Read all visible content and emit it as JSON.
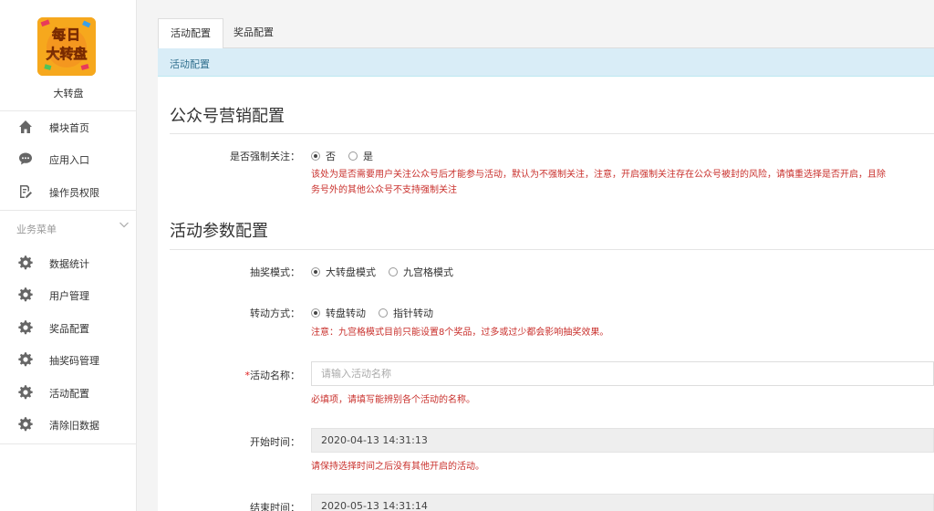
{
  "app": {
    "name": "大转盘",
    "logo_text_top": "每日",
    "logo_text_bottom": "大转盘"
  },
  "sidebar": {
    "items": [
      {
        "label": "模块首页",
        "icon": "home-icon"
      },
      {
        "label": "应用入口",
        "icon": "chat-bubble-icon"
      },
      {
        "label": "操作员权限",
        "icon": "edit-document-icon"
      }
    ],
    "group_title": "业务菜单",
    "group_items": [
      {
        "label": "数据统计",
        "icon": "gear-icon"
      },
      {
        "label": "用户管理",
        "icon": "gear-icon"
      },
      {
        "label": "奖品配置",
        "icon": "gear-icon"
      },
      {
        "label": "抽奖码管理",
        "icon": "gear-icon"
      },
      {
        "label": "活动配置",
        "icon": "gear-icon"
      },
      {
        "label": "清除旧数据",
        "icon": "gear-icon"
      }
    ]
  },
  "tabs": [
    {
      "label": "活动配置",
      "active": true
    },
    {
      "label": "奖品配置",
      "active": false
    }
  ],
  "panel_title": "活动配置",
  "section1": {
    "title": "公众号营销配置",
    "force_follow": {
      "label": "是否强制关注：",
      "options": [
        "否",
        "是"
      ],
      "selected": 0,
      "hint_line1": "该处为是否需要用户关注公众号后才能参与活动，默认为不强制关注，注意，开启强制关注存在公众号被封的风险，请慎重选择是否开启，且除",
      "hint_line2": "务号外的其他公众号不支持强制关注"
    }
  },
  "section2": {
    "title": "活动参数配置",
    "lottery_mode": {
      "label": "抽奖模式：",
      "options": [
        "大转盘模式",
        "九宫格模式"
      ],
      "selected": 0
    },
    "rotate_mode": {
      "label": "转动方式：",
      "options": [
        "转盘转动",
        "指针转动"
      ],
      "selected": 0,
      "hint": "注意：九宫格模式目前只能设置8个奖品，过多或过少都会影响抽奖效果。"
    },
    "activity_name": {
      "required_mark": "*",
      "label": "活动名称：",
      "placeholder": "请输入活动名称",
      "value": "",
      "hint": "必填项，请填写能辨别各个活动的名称。"
    },
    "start_time": {
      "label": "开始时间：",
      "value": "2020-04-13 14:31:13",
      "hint": "请保持选择时间之后没有其他开启的活动。"
    },
    "end_time": {
      "label": "结束时间：",
      "value": "2020-05-13 14:31:14"
    }
  },
  "colors": {
    "accent_bg": "#d9edf7",
    "accent_text": "#31708f",
    "hint_red": "#c9302c",
    "logo_orange": "#f6a81d"
  }
}
